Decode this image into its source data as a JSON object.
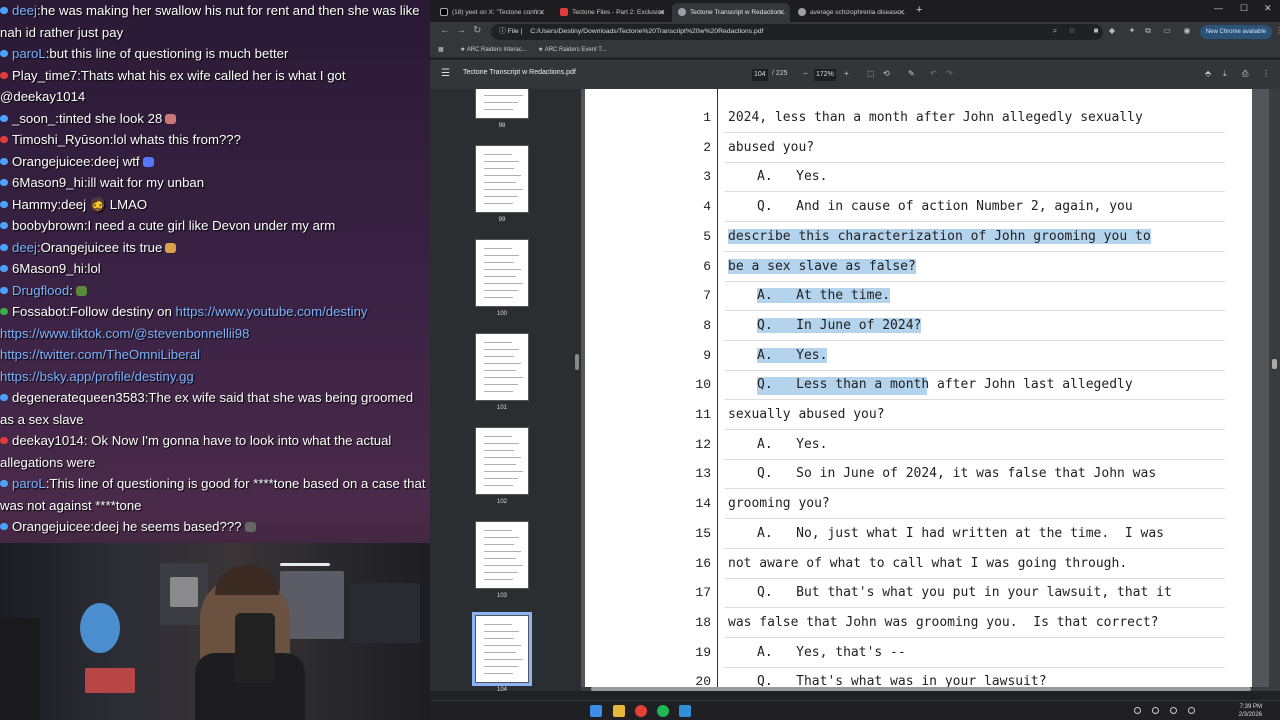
{
  "chat": {
    "messages": [
      {
        "user": "deej",
        "user_color": "#7db3ff",
        "badge": "#4aa3ff",
        "text": "he was making her swallow his nut for rent and then she was like nah id rather just pay",
        "emote": ""
      },
      {
        "user": "paroL",
        "user_color": "#7db3ff",
        "badge": "#4aa3ff",
        "text": "but this line of questioning is much better",
        "emote": ""
      },
      {
        "user": "Play_time7",
        "user_color": "#ffffff",
        "badge": "#e23b3b",
        "text": "Thats what his ex wife called her is what I got @deekay1014",
        "emote": ""
      },
      {
        "user": "_soon_",
        "user_color": "#ffffff",
        "badge": "#4aa3ff",
        "text": "tinted she look 28",
        "emote": "#c77"
      },
      {
        "user": "Timoshi_Ryūson",
        "user_color": "#ffffff",
        "badge": "#e23b3b",
        "text": "lol whats this from???",
        "emote": ""
      },
      {
        "user": "Orangejuicee",
        "user_color": "#ffffff",
        "badge": "#4aa3ff",
        "text": "deej wtf",
        "emote": "#5577ff"
      },
      {
        "user": "6Mason9_hi",
        "user_color": "#ffffff",
        "badge": "#4aa3ff",
        "text": "ill wait for my unban",
        "emote": ""
      },
      {
        "user": "Hammy",
        "user_color": "#ffffff",
        "badge": "#4aa3ff",
        "text": "deej 🧔 LMAO",
        "emote": ""
      },
      {
        "user": "boobybrown",
        "user_color": "#ffffff",
        "badge": "#4aa3ff",
        "text": "I need a cute girl like Devon under my arm",
        "emote": ""
      },
      {
        "user": "deej",
        "user_color": "#7db3ff",
        "badge": "#4aa3ff",
        "text": "Orangejuicee its true",
        "emote": "#d9a24a"
      },
      {
        "user": "6Mason9_hi",
        "user_color": "#ffffff",
        "badge": "#4aa3ff",
        "text": "lol",
        "emote": ""
      },
      {
        "user": "Drugflood",
        "user_color": "#7db3ff",
        "badge": "#4aa3ff",
        "text": "",
        "emote": "#5a8a3a"
      },
      {
        "user": "Fossabot",
        "user_color": "#ffffff",
        "badge": "#3cb043",
        "text": "Follow destiny on ",
        "links": [
          "https://www.youtube.com/destiny",
          "https://www.tiktok.com/@stevenbonnellii98",
          "https://twitter.com/TheOmniLiberal",
          "https://bsky.app/profile/destiny.gg"
        ],
        "emote": ""
      },
      {
        "user": "degeneratequeen3583",
        "user_color": "#ffffff",
        "badge": "#4aa3ff",
        "text": "The ex wife said that she was being groomed as a sex slave",
        "emote": ""
      },
      {
        "user": "deekay1014",
        "user_color": "#ffffff",
        "badge": "#e23b3b",
        "text": " Ok Now I'm gonna have to look into what the actual allegations were",
        "emote": ""
      },
      {
        "user": "paroL",
        "user_color": "#7db3ff",
        "badge": "#4aa3ff",
        "text": "This line of questioning is good for ****tone based on a case that was not against ****tone",
        "emote": ""
      },
      {
        "user": "Orangejuicee",
        "user_color": "#ffffff",
        "badge": "#4aa3ff",
        "text": "deej he seems based???",
        "emote": "#666"
      }
    ]
  },
  "browser": {
    "tabs": [
      {
        "label": "(18) yeet on X: \"Tectone confir...",
        "icon_color": "#ffffff",
        "active": false
      },
      {
        "label": "Tectone Files - Part 2: Exclusive",
        "icon_color": "#e23b3b",
        "active": false
      },
      {
        "label": "Tectone Transcript w Redaction...",
        "icon_color": "#9aa0a6",
        "active": true
      },
      {
        "label": "average schizophrenia disease...",
        "icon_color": "#9aa0a6",
        "active": false
      }
    ],
    "url_chip": "File",
    "url": "C:/Users/Destiny/Downloads/Tectone%20Transcript%20w%20Redactions.pdf",
    "update_button": "New Chrome available",
    "bookmarks": [
      "ARC Raiders Interac...",
      "ARC Raiders Event T..."
    ]
  },
  "pdf": {
    "title": "Tectone Transcript w Redactions.pdf",
    "current_page": "104",
    "total_pages": "/ 225",
    "zoom": "172%",
    "thumbnails": [
      "98",
      "99",
      "100",
      "101",
      "102",
      "103",
      "104"
    ],
    "lines": [
      {
        "n": "1",
        "indent": 0,
        "text": "2024, less than a month after John allegedly sexually",
        "hl": ""
      },
      {
        "n": "2",
        "indent": 0,
        "text": "abused you?",
        "hl": ""
      },
      {
        "n": "3",
        "indent": 1,
        "text": "A.   Yes.",
        "hl": ""
      },
      {
        "n": "4",
        "indent": 1,
        "text": "Q.   And in cause of action Number 2, again, you",
        "hl": ""
      },
      {
        "n": "5",
        "indent": 0,
        "text": "describe this characterization of John grooming you to",
        "hl": "full"
      },
      {
        "n": "6",
        "indent": 0,
        "text": "be a sex slave as false?",
        "hl": "full"
      },
      {
        "n": "7",
        "indent": 1,
        "text": "A.   At the time.",
        "hl": "full"
      },
      {
        "n": "8",
        "indent": 1,
        "text": "Q.   In June of 2024?",
        "hl": "full"
      },
      {
        "n": "9",
        "indent": 1,
        "text": "A.   Yes.",
        "hl": "full"
      },
      {
        "n": "10",
        "indent": 1,
        "text": "Q.   Less than a month after John last allegedly",
        "hl": "partial"
      },
      {
        "n": "11",
        "indent": 0,
        "text": "sexually abused you?",
        "hl": ""
      },
      {
        "n": "12",
        "indent": 1,
        "text": "A.   Yes.",
        "hl": ""
      },
      {
        "n": "13",
        "indent": 1,
        "text": "Q.   So in June of 2024, it was false that John was",
        "hl": ""
      },
      {
        "n": "14",
        "indent": 0,
        "text": "grooming you?",
        "hl": ""
      },
      {
        "n": "15",
        "indent": 1,
        "text": "A.   No, just what I had written at the time.  I was",
        "hl": ""
      },
      {
        "n": "16",
        "indent": 0,
        "text": "not aware of what to call what I was going through.",
        "hl": ""
      },
      {
        "n": "17",
        "indent": 1,
        "text": "Q.   But that's what you put in your lawsuit, that it",
        "hl": ""
      },
      {
        "n": "18",
        "indent": 0,
        "text": "was false that John was grooming you.  Is that correct?",
        "hl": ""
      },
      {
        "n": "19",
        "indent": 1,
        "text": "A.   Yes, that's --",
        "hl": ""
      },
      {
        "n": "20",
        "indent": 1,
        "text": "Q.   That's what was in your lawsuit?",
        "hl": ""
      }
    ]
  },
  "taskbar": {
    "time": "7:39 PM",
    "date": "2/3/2026"
  }
}
